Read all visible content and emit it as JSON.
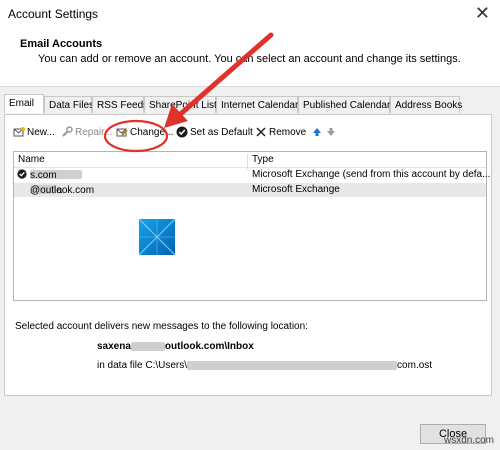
{
  "window": {
    "title": "Account Settings",
    "close_glyph": "✕"
  },
  "header": {
    "title": "Email Accounts",
    "subtitle": "You can add or remove an account. You can select an account and change its settings."
  },
  "tabs": [
    {
      "label": "Email",
      "active": true
    },
    {
      "label": "Data Files"
    },
    {
      "label": "RSS Feeds"
    },
    {
      "label": "SharePoint Lists"
    },
    {
      "label": "Internet Calendars"
    },
    {
      "label": "Published Calendars"
    },
    {
      "label": "Address Books"
    }
  ],
  "toolbar": {
    "new": "New...",
    "repair": "Repair...",
    "change": "Change...",
    "default": "Set as Default",
    "remove": "Remove"
  },
  "accounts": {
    "col_name": "Name",
    "col_type": "Type",
    "rows": [
      {
        "name_start": "Admin",
        "name_end": "s.com",
        "type": "Microsoft Exchange (send from this account by defa...",
        "default": true
      },
      {
        "name_start": "saxena",
        "name_end": "@outlook.com",
        "type": "Microsoft Exchange",
        "selected": true
      }
    ]
  },
  "delivery": {
    "text": "Selected account delivers new messages to the following location:",
    "folder_start": "saxena",
    "folder_end": "outlook.com\\Inbox",
    "file_start": "in data file C:\\Users\\",
    "file_end": "com.ost"
  },
  "footer": {
    "close": "Close"
  },
  "watermark": "wsxdn.com",
  "colors": {
    "annotation": "#e0312b",
    "accent": "#0078d7"
  }
}
